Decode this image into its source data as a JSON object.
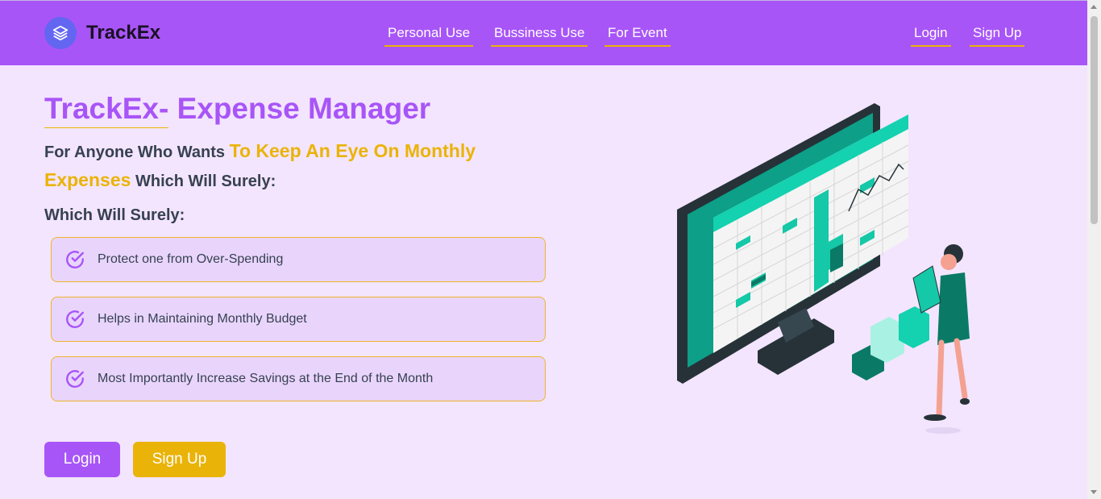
{
  "navbar": {
    "brand": "TrackEx",
    "links": [
      "Personal Use",
      "Bussiness Use",
      "For Event"
    ],
    "login": "Login",
    "signup": "Sign Up"
  },
  "hero": {
    "title_part1": "TrackEx-",
    "title_part2": "Expense Manager",
    "subtitle_pre": "For Anyone Who Wants",
    "subtitle_highlight": "To Keep An Eye On Monthly Expenses",
    "subtitle_post": "Which Will Surely:",
    "section_label": "Which Will Surely:",
    "features": [
      "Protect one from Over-Spending",
      "Helps in Maintaining Monthly Budget",
      "Most Importantly Increase Savings at the End of the Month"
    ],
    "login_button": "Login",
    "signup_button": "Sign Up"
  },
  "colors": {
    "accent_purple": "#a855f7",
    "accent_yellow": "#eab308",
    "background": "#f3e5fe",
    "card_bg": "#e9d5fc",
    "illustration_teal": "#0fbf9f"
  },
  "icons": {
    "brand_logo": "layers-icon",
    "feature_check": "check-circle-icon"
  }
}
